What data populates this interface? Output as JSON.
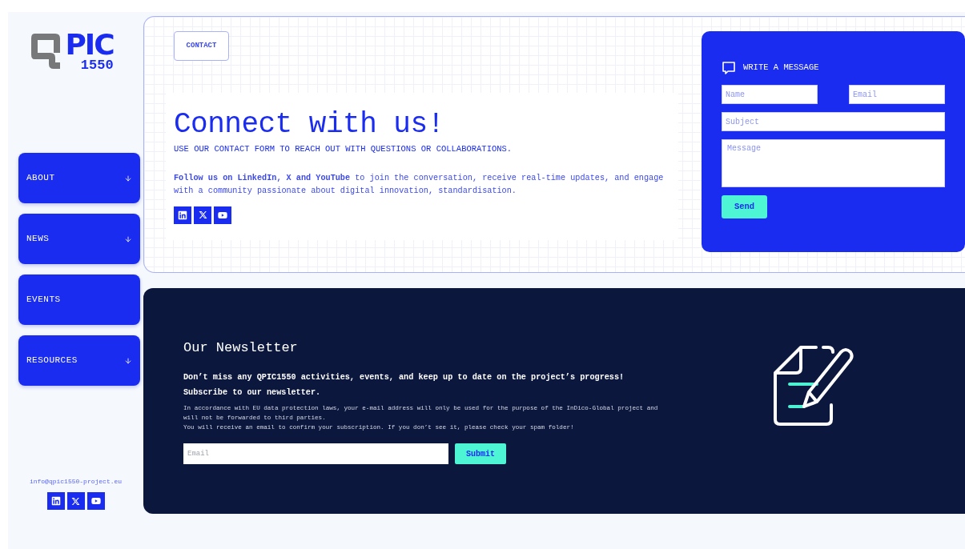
{
  "logo": {
    "letters": "PIC",
    "number": "1550"
  },
  "nav": [
    {
      "label": "ABOUT",
      "has_submenu": true
    },
    {
      "label": "NEWS",
      "has_submenu": true
    },
    {
      "label": "EVENTS",
      "has_submenu": false
    },
    {
      "label": "RESOURCES",
      "has_submenu": true
    }
  ],
  "sidebar_footer": {
    "email": "info@qpic1550-project.eu",
    "socials": [
      {
        "kind": "linkedin"
      },
      {
        "kind": "x"
      },
      {
        "kind": "youtube"
      }
    ]
  },
  "contact": {
    "tag": "CONTACT",
    "title": "Connect with us!",
    "subtitle": "USE OUR CONTACT FORM TO REACH OUT WITH QUESTIONS OR COLLABORATIONS.",
    "text": "**Follow us on LinkedIn, X and YouTube** to join the conversation, receive real-time updates, and engage with a community passionate about digital innovation, standardisation.",
    "socials": [
      {
        "kind": "linkedin"
      },
      {
        "kind": "x"
      },
      {
        "kind": "youtube"
      }
    ]
  },
  "message_form": {
    "title": "WRITE A MESSAGE",
    "name_placeholder": "Name",
    "email_placeholder": "Email",
    "subject_placeholder": "Subject",
    "message_placeholder": "Message",
    "button": "Send"
  },
  "newsletter": {
    "title": "Our Newsletter",
    "lead": "Don’t miss any QPIC1550 activities, events, and keep up to date on the project’s progress!",
    "cta": "Subscribe to our newsletter.",
    "notice": [
      "In accordance with EU data protection laws, your e-mail address will only be used for the purpose of the InDico-Global project and will not be forwarded to third parties.",
      "You will receive an email to confirm your subscription. If you don’t see it, please check your spam folder!"
    ],
    "email_placeholder": "Email",
    "button": "Submit"
  }
}
